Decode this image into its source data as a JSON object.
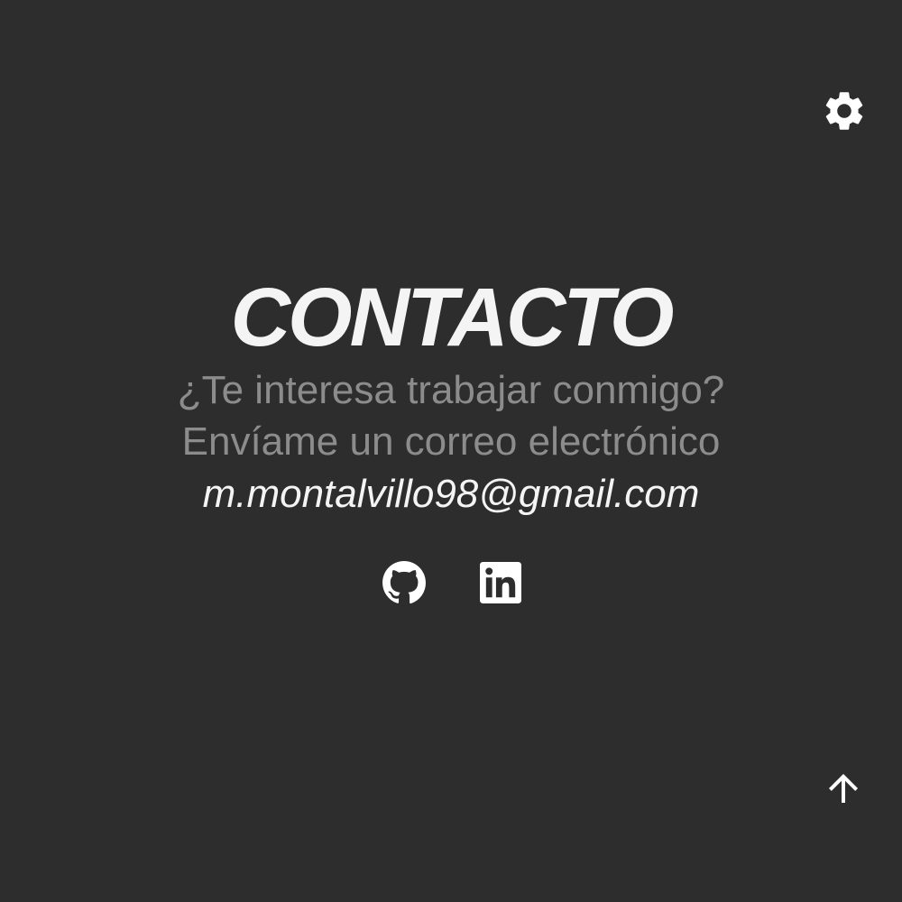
{
  "contact": {
    "title": "CONTACTO",
    "subtitle_line1": "¿Te interesa trabajar conmigo?",
    "subtitle_line2": "Envíame un correo electrónico",
    "email": "m.montalvillo98@gmail.com"
  },
  "socials": [
    {
      "icon": "github-icon"
    },
    {
      "icon": "linkedin-icon"
    }
  ],
  "controls": {
    "settings_icon": "gear-icon",
    "scroll_top_icon": "arrow-up-icon"
  },
  "colors": {
    "background": "#2d2d2d",
    "title": "#f4f4f4",
    "subtitle": "#8c8c8c",
    "icon": "#ffffff"
  }
}
